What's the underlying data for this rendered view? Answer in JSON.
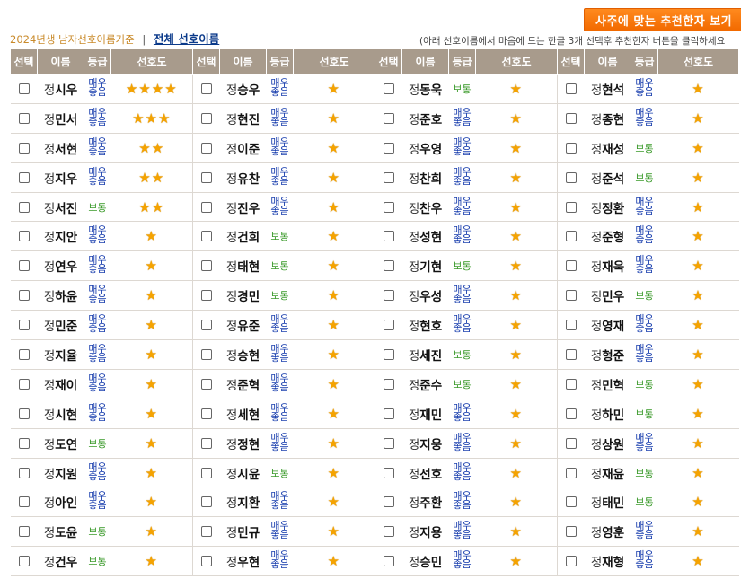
{
  "header": {
    "recommend_button": "사주에 맞는 추천한자 보기",
    "recommend_arrow": "›",
    "criteria_text": "2024년생 남자선호이름기준",
    "separator": "|",
    "all_names_link": "전체 선호이름",
    "hint_text": "(아래 선호이름에서 마음에 드는 한글 3개 선택후 추천한자 버튼을 클릭하세요"
  },
  "columns": [
    "선택",
    "이름",
    "등급",
    "선호도"
  ],
  "surname": "정",
  "grade_labels": {
    "top": "매우\n좋음",
    "normal": "보통"
  },
  "groups": [
    {
      "rows": [
        {
          "given": "시우",
          "grade": "top",
          "stars": 4
        },
        {
          "given": "민서",
          "grade": "top",
          "stars": 3
        },
        {
          "given": "서현",
          "grade": "top",
          "stars": 2
        },
        {
          "given": "지우",
          "grade": "top",
          "stars": 2
        },
        {
          "given": "서진",
          "grade": "normal",
          "stars": 2
        },
        {
          "given": "지안",
          "grade": "top",
          "stars": 1
        },
        {
          "given": "연우",
          "grade": "top",
          "stars": 1
        },
        {
          "given": "하윤",
          "grade": "top",
          "stars": 1
        },
        {
          "given": "민준",
          "grade": "top",
          "stars": 1
        },
        {
          "given": "지율",
          "grade": "top",
          "stars": 1
        },
        {
          "given": "재이",
          "grade": "top",
          "stars": 1
        },
        {
          "given": "시현",
          "grade": "top",
          "stars": 1
        },
        {
          "given": "도연",
          "grade": "normal",
          "stars": 1
        },
        {
          "given": "지원",
          "grade": "top",
          "stars": 1
        },
        {
          "given": "아인",
          "grade": "top",
          "stars": 1
        },
        {
          "given": "도윤",
          "grade": "normal",
          "stars": 1
        },
        {
          "given": "건우",
          "grade": "normal",
          "stars": 1
        }
      ]
    },
    {
      "rows": [
        {
          "given": "승우",
          "grade": "top",
          "stars": 1
        },
        {
          "given": "현진",
          "grade": "top",
          "stars": 1
        },
        {
          "given": "이준",
          "grade": "top",
          "stars": 1
        },
        {
          "given": "유찬",
          "grade": "top",
          "stars": 1
        },
        {
          "given": "진우",
          "grade": "top",
          "stars": 1
        },
        {
          "given": "건희",
          "grade": "normal",
          "stars": 1
        },
        {
          "given": "태현",
          "grade": "normal",
          "stars": 1
        },
        {
          "given": "경민",
          "grade": "normal",
          "stars": 1
        },
        {
          "given": "유준",
          "grade": "top",
          "stars": 1
        },
        {
          "given": "승현",
          "grade": "top",
          "stars": 1
        },
        {
          "given": "준혁",
          "grade": "top",
          "stars": 1
        },
        {
          "given": "세현",
          "grade": "top",
          "stars": 1
        },
        {
          "given": "정현",
          "grade": "top",
          "stars": 1
        },
        {
          "given": "시윤",
          "grade": "normal",
          "stars": 1
        },
        {
          "given": "지환",
          "grade": "top",
          "stars": 1
        },
        {
          "given": "민규",
          "grade": "top",
          "stars": 1
        },
        {
          "given": "우현",
          "grade": "top",
          "stars": 1
        }
      ]
    },
    {
      "rows": [
        {
          "given": "동욱",
          "grade": "normal",
          "stars": 1
        },
        {
          "given": "준호",
          "grade": "top",
          "stars": 1
        },
        {
          "given": "우영",
          "grade": "top",
          "stars": 1
        },
        {
          "given": "찬희",
          "grade": "top",
          "stars": 1
        },
        {
          "given": "찬우",
          "grade": "top",
          "stars": 1
        },
        {
          "given": "성현",
          "grade": "top",
          "stars": 1
        },
        {
          "given": "기현",
          "grade": "normal",
          "stars": 1
        },
        {
          "given": "우성",
          "grade": "top",
          "stars": 1
        },
        {
          "given": "현호",
          "grade": "top",
          "stars": 1
        },
        {
          "given": "세진",
          "grade": "normal",
          "stars": 1
        },
        {
          "given": "준수",
          "grade": "normal",
          "stars": 1
        },
        {
          "given": "재민",
          "grade": "top",
          "stars": 1
        },
        {
          "given": "지웅",
          "grade": "top",
          "stars": 1
        },
        {
          "given": "선호",
          "grade": "top",
          "stars": 1
        },
        {
          "given": "주환",
          "grade": "top",
          "stars": 1
        },
        {
          "given": "지용",
          "grade": "top",
          "stars": 1
        },
        {
          "given": "승민",
          "grade": "top",
          "stars": 1
        }
      ]
    },
    {
      "rows": [
        {
          "given": "현석",
          "grade": "top",
          "stars": 1
        },
        {
          "given": "종현",
          "grade": "top",
          "stars": 1
        },
        {
          "given": "재성",
          "grade": "normal",
          "stars": 1
        },
        {
          "given": "준석",
          "grade": "normal",
          "stars": 1
        },
        {
          "given": "정환",
          "grade": "top",
          "stars": 1
        },
        {
          "given": "준형",
          "grade": "top",
          "stars": 1
        },
        {
          "given": "재욱",
          "grade": "top",
          "stars": 1
        },
        {
          "given": "민우",
          "grade": "normal",
          "stars": 1
        },
        {
          "given": "영재",
          "grade": "top",
          "stars": 1
        },
        {
          "given": "형준",
          "grade": "top",
          "stars": 1
        },
        {
          "given": "민혁",
          "grade": "normal",
          "stars": 1
        },
        {
          "given": "하민",
          "grade": "normal",
          "stars": 1
        },
        {
          "given": "상원",
          "grade": "top",
          "stars": 1
        },
        {
          "given": "재윤",
          "grade": "normal",
          "stars": 1
        },
        {
          "given": "태민",
          "grade": "normal",
          "stars": 1
        },
        {
          "given": "영훈",
          "grade": "top",
          "stars": 1
        },
        {
          "given": "재형",
          "grade": "top",
          "stars": 1
        }
      ]
    }
  ],
  "colors": {
    "header_bg": "#a89b8c",
    "button_bg": "#f26a00",
    "grade_top": "#1a3fae",
    "grade_normal": "#3a9a2a",
    "star": "#f5a300"
  },
  "icons": {
    "star": "star-icon",
    "checkbox": "checkbox"
  }
}
